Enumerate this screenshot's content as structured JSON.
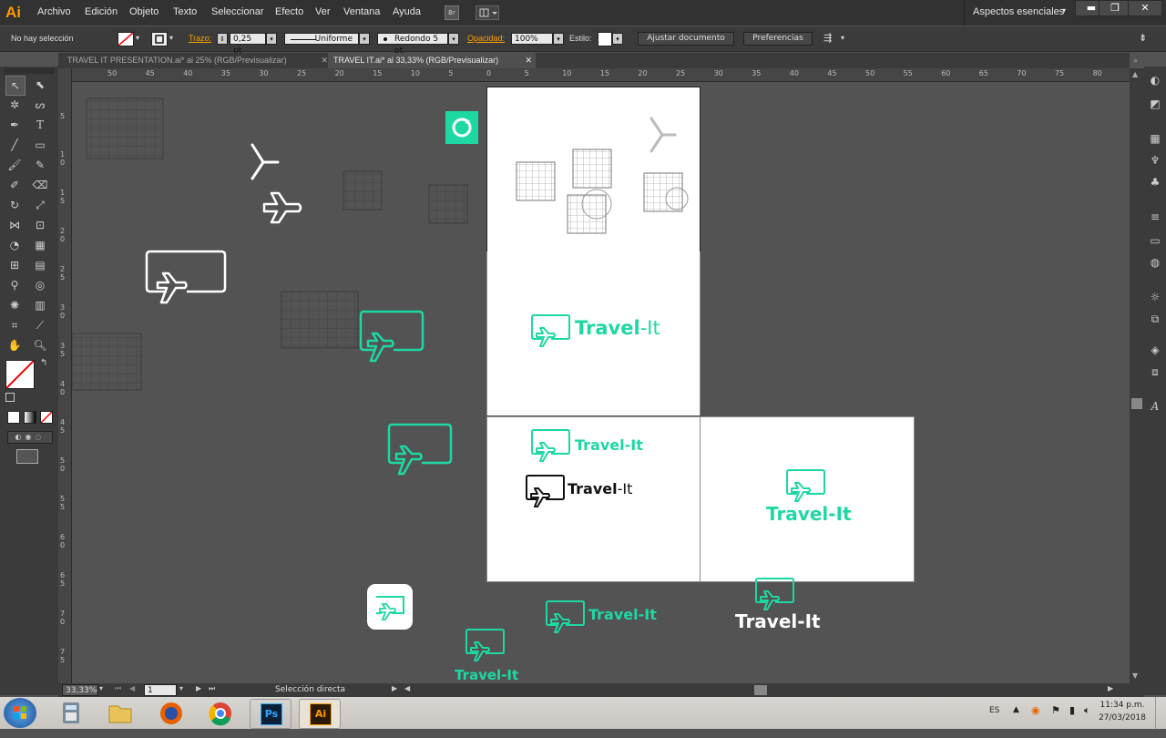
{
  "app": {
    "logo": "Ai",
    "accent": "#ff9a00",
    "brand_green": "#1ed8a4"
  },
  "menu": [
    "Archivo",
    "Edición",
    "Objeto",
    "Texto",
    "Seleccionar",
    "Efecto",
    "Ver",
    "Ventana",
    "Ayuda"
  ],
  "menubar_badge": "Br",
  "workspace": "Aspectos esenciales",
  "window_controls": {
    "minimize": "▬",
    "restore": "❐",
    "close": "✕"
  },
  "control": {
    "selection": "No hay selección",
    "stroke_label": "Trazo:",
    "stroke_value": "0,25 pt",
    "profile": "Uniforme",
    "brush": "Redondo 5 pt.",
    "opacity_label": "Opacidad:",
    "opacity_value": "100%",
    "style_label": "Estilo:",
    "fit_button": "Ajustar documento",
    "prefs_button": "Preferencias"
  },
  "tabs": [
    {
      "label": "TRAVEL IT PRESENTATION.ai* al 25% (RGB/Previsualizar)",
      "close": "✕"
    },
    {
      "label": "TRAVEL IT.ai* al 33,33% (RGB/Previsualizar)",
      "close": "✕"
    }
  ],
  "ruler_top": [
    "50",
    "45",
    "40",
    "35",
    "30",
    "25",
    "20",
    "15",
    "10",
    "5",
    "0",
    "5",
    "10",
    "15",
    "20",
    "25",
    "30",
    "35",
    "40",
    "45",
    "50",
    "55",
    "60",
    "65",
    "70",
    "75",
    "80"
  ],
  "ruler_left": [
    "5",
    "1\n0",
    "1\n5",
    "2\n0",
    "2\n5",
    "3\n0",
    "3\n5",
    "4\n0",
    "4\n5",
    "5\n0",
    "5\n5",
    "6\n0",
    "6\n5",
    "7\n0",
    "7\n5"
  ],
  "status": {
    "zoom": "33,33%",
    "artboard": "1",
    "tool": "Selección directa"
  },
  "logo": {
    "name_a": "Travel",
    "name_b": "-It"
  },
  "taskbar": {
    "lang": "ES",
    "time": "11:34 p.m.",
    "date": "27/03/2018",
    "ps": "Ps",
    "ai": "Ai"
  }
}
